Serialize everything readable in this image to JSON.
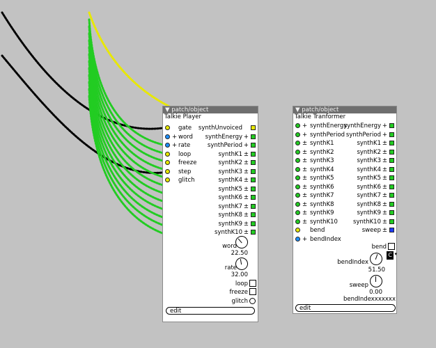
{
  "panels": [
    {
      "id": "talkie-player",
      "title": "patch/object",
      "name": "Talkie Player",
      "inlets": [
        {
          "sign": "",
          "label": "gate",
          "color": "#e8e800"
        },
        {
          "sign": "+",
          "label": "word",
          "color": "#1e90ff"
        },
        {
          "sign": "+",
          "label": "rate",
          "color": "#1e90ff"
        },
        {
          "sign": "",
          "label": "loop",
          "color": "#e8e800"
        },
        {
          "sign": "",
          "label": "freeze",
          "color": "#e8e800"
        },
        {
          "sign": "",
          "label": "step",
          "color": "#e8e800"
        },
        {
          "sign": "",
          "label": "glitch",
          "color": "#e8e800"
        }
      ],
      "outlets": [
        {
          "label": "synthUnvoiced",
          "sign": "",
          "color": "#e8e800"
        },
        {
          "label": "synthEnergy",
          "sign": "+",
          "color": "#22cc22"
        },
        {
          "label": "synthPeriod",
          "sign": "+",
          "color": "#22cc22"
        },
        {
          "label": "synthK1",
          "sign": "±",
          "color": "#22cc22"
        },
        {
          "label": "synthK2",
          "sign": "±",
          "color": "#22cc22"
        },
        {
          "label": "synthK3",
          "sign": "±",
          "color": "#22cc22"
        },
        {
          "label": "synthK4",
          "sign": "±",
          "color": "#22cc22"
        },
        {
          "label": "synthK5",
          "sign": "±",
          "color": "#22cc22"
        },
        {
          "label": "synthK6",
          "sign": "±",
          "color": "#22cc22"
        },
        {
          "label": "synthK7",
          "sign": "±",
          "color": "#22cc22"
        },
        {
          "label": "synthK8",
          "sign": "±",
          "color": "#22cc22"
        },
        {
          "label": "synthK9",
          "sign": "±",
          "color": "#22cc22"
        },
        {
          "label": "synthK10",
          "sign": "±",
          "color": "#22cc22"
        }
      ],
      "params": [
        {
          "label": "word",
          "value": "22.50",
          "kind": "knob"
        },
        {
          "label": "rate",
          "value": "32.00",
          "kind": "knob"
        },
        {
          "label": "loop",
          "kind": "toggle"
        },
        {
          "label": "freeze",
          "kind": "toggle"
        },
        {
          "label": "glitch",
          "kind": "bang"
        }
      ],
      "edit_label": "edit"
    },
    {
      "id": "talkie-transformer",
      "title": "patch/object",
      "name": "Talkie Tranformer",
      "inlets": [
        {
          "sign": "+",
          "label": "synthEnergy",
          "color": "#22cc22"
        },
        {
          "sign": "+",
          "label": "synthPeriod",
          "color": "#22cc22"
        },
        {
          "sign": "±",
          "label": "synthK1",
          "color": "#22cc22"
        },
        {
          "sign": "±",
          "label": "synthK2",
          "color": "#22cc22"
        },
        {
          "sign": "±",
          "label": "synthK3",
          "color": "#22cc22"
        },
        {
          "sign": "±",
          "label": "synthK4",
          "color": "#22cc22"
        },
        {
          "sign": "±",
          "label": "synthK5",
          "color": "#22cc22"
        },
        {
          "sign": "±",
          "label": "synthK6",
          "color": "#22cc22"
        },
        {
          "sign": "±",
          "label": "synthK7",
          "color": "#22cc22"
        },
        {
          "sign": "±",
          "label": "synthK8",
          "color": "#22cc22"
        },
        {
          "sign": "±",
          "label": "synthK9",
          "color": "#22cc22"
        },
        {
          "sign": "±",
          "label": "synthK10",
          "color": "#22cc22"
        },
        {
          "sign": "",
          "label": "bend",
          "color": "#e8e800"
        },
        {
          "sign": "+",
          "label": "bendIndex",
          "color": "#1e90ff"
        }
      ],
      "outlets": [
        {
          "label": "synthEnergy",
          "sign": "+",
          "color": "#22cc22"
        },
        {
          "label": "synthPeriod",
          "sign": "+",
          "color": "#22cc22"
        },
        {
          "label": "synthK1",
          "sign": "±",
          "color": "#22cc22"
        },
        {
          "label": "synthK2",
          "sign": "±",
          "color": "#22cc22"
        },
        {
          "label": "synthK3",
          "sign": "±",
          "color": "#22cc22"
        },
        {
          "label": "synthK4",
          "sign": "±",
          "color": "#22cc22"
        },
        {
          "label": "synthK5",
          "sign": "±",
          "color": "#22cc22"
        },
        {
          "label": "synthK6",
          "sign": "±",
          "color": "#22cc22"
        },
        {
          "label": "synthK7",
          "sign": "±",
          "color": "#22cc22"
        },
        {
          "label": "synthK8",
          "sign": "±",
          "color": "#22cc22"
        },
        {
          "label": "synthK9",
          "sign": "±",
          "color": "#22cc22"
        },
        {
          "label": "synthK10",
          "sign": "±",
          "color": "#22cc22"
        },
        {
          "label": "sweep",
          "sign": "±",
          "color": "#1e3cff"
        }
      ],
      "params": [
        {
          "label": "bend",
          "kind": "toggle"
        },
        {
          "label": "bendIndex",
          "value": "51.50",
          "kind": "knob"
        },
        {
          "label": "sweep",
          "value": "0.00",
          "kind": "knob"
        },
        {
          "label": "bendIndexxxxxxx",
          "kind": "text"
        }
      ],
      "dropdown_value": "C",
      "edit_label": "edit"
    }
  ],
  "wire_colors": {
    "green": "#22cc22",
    "yellow": "#e8e800",
    "black": "#000000"
  }
}
